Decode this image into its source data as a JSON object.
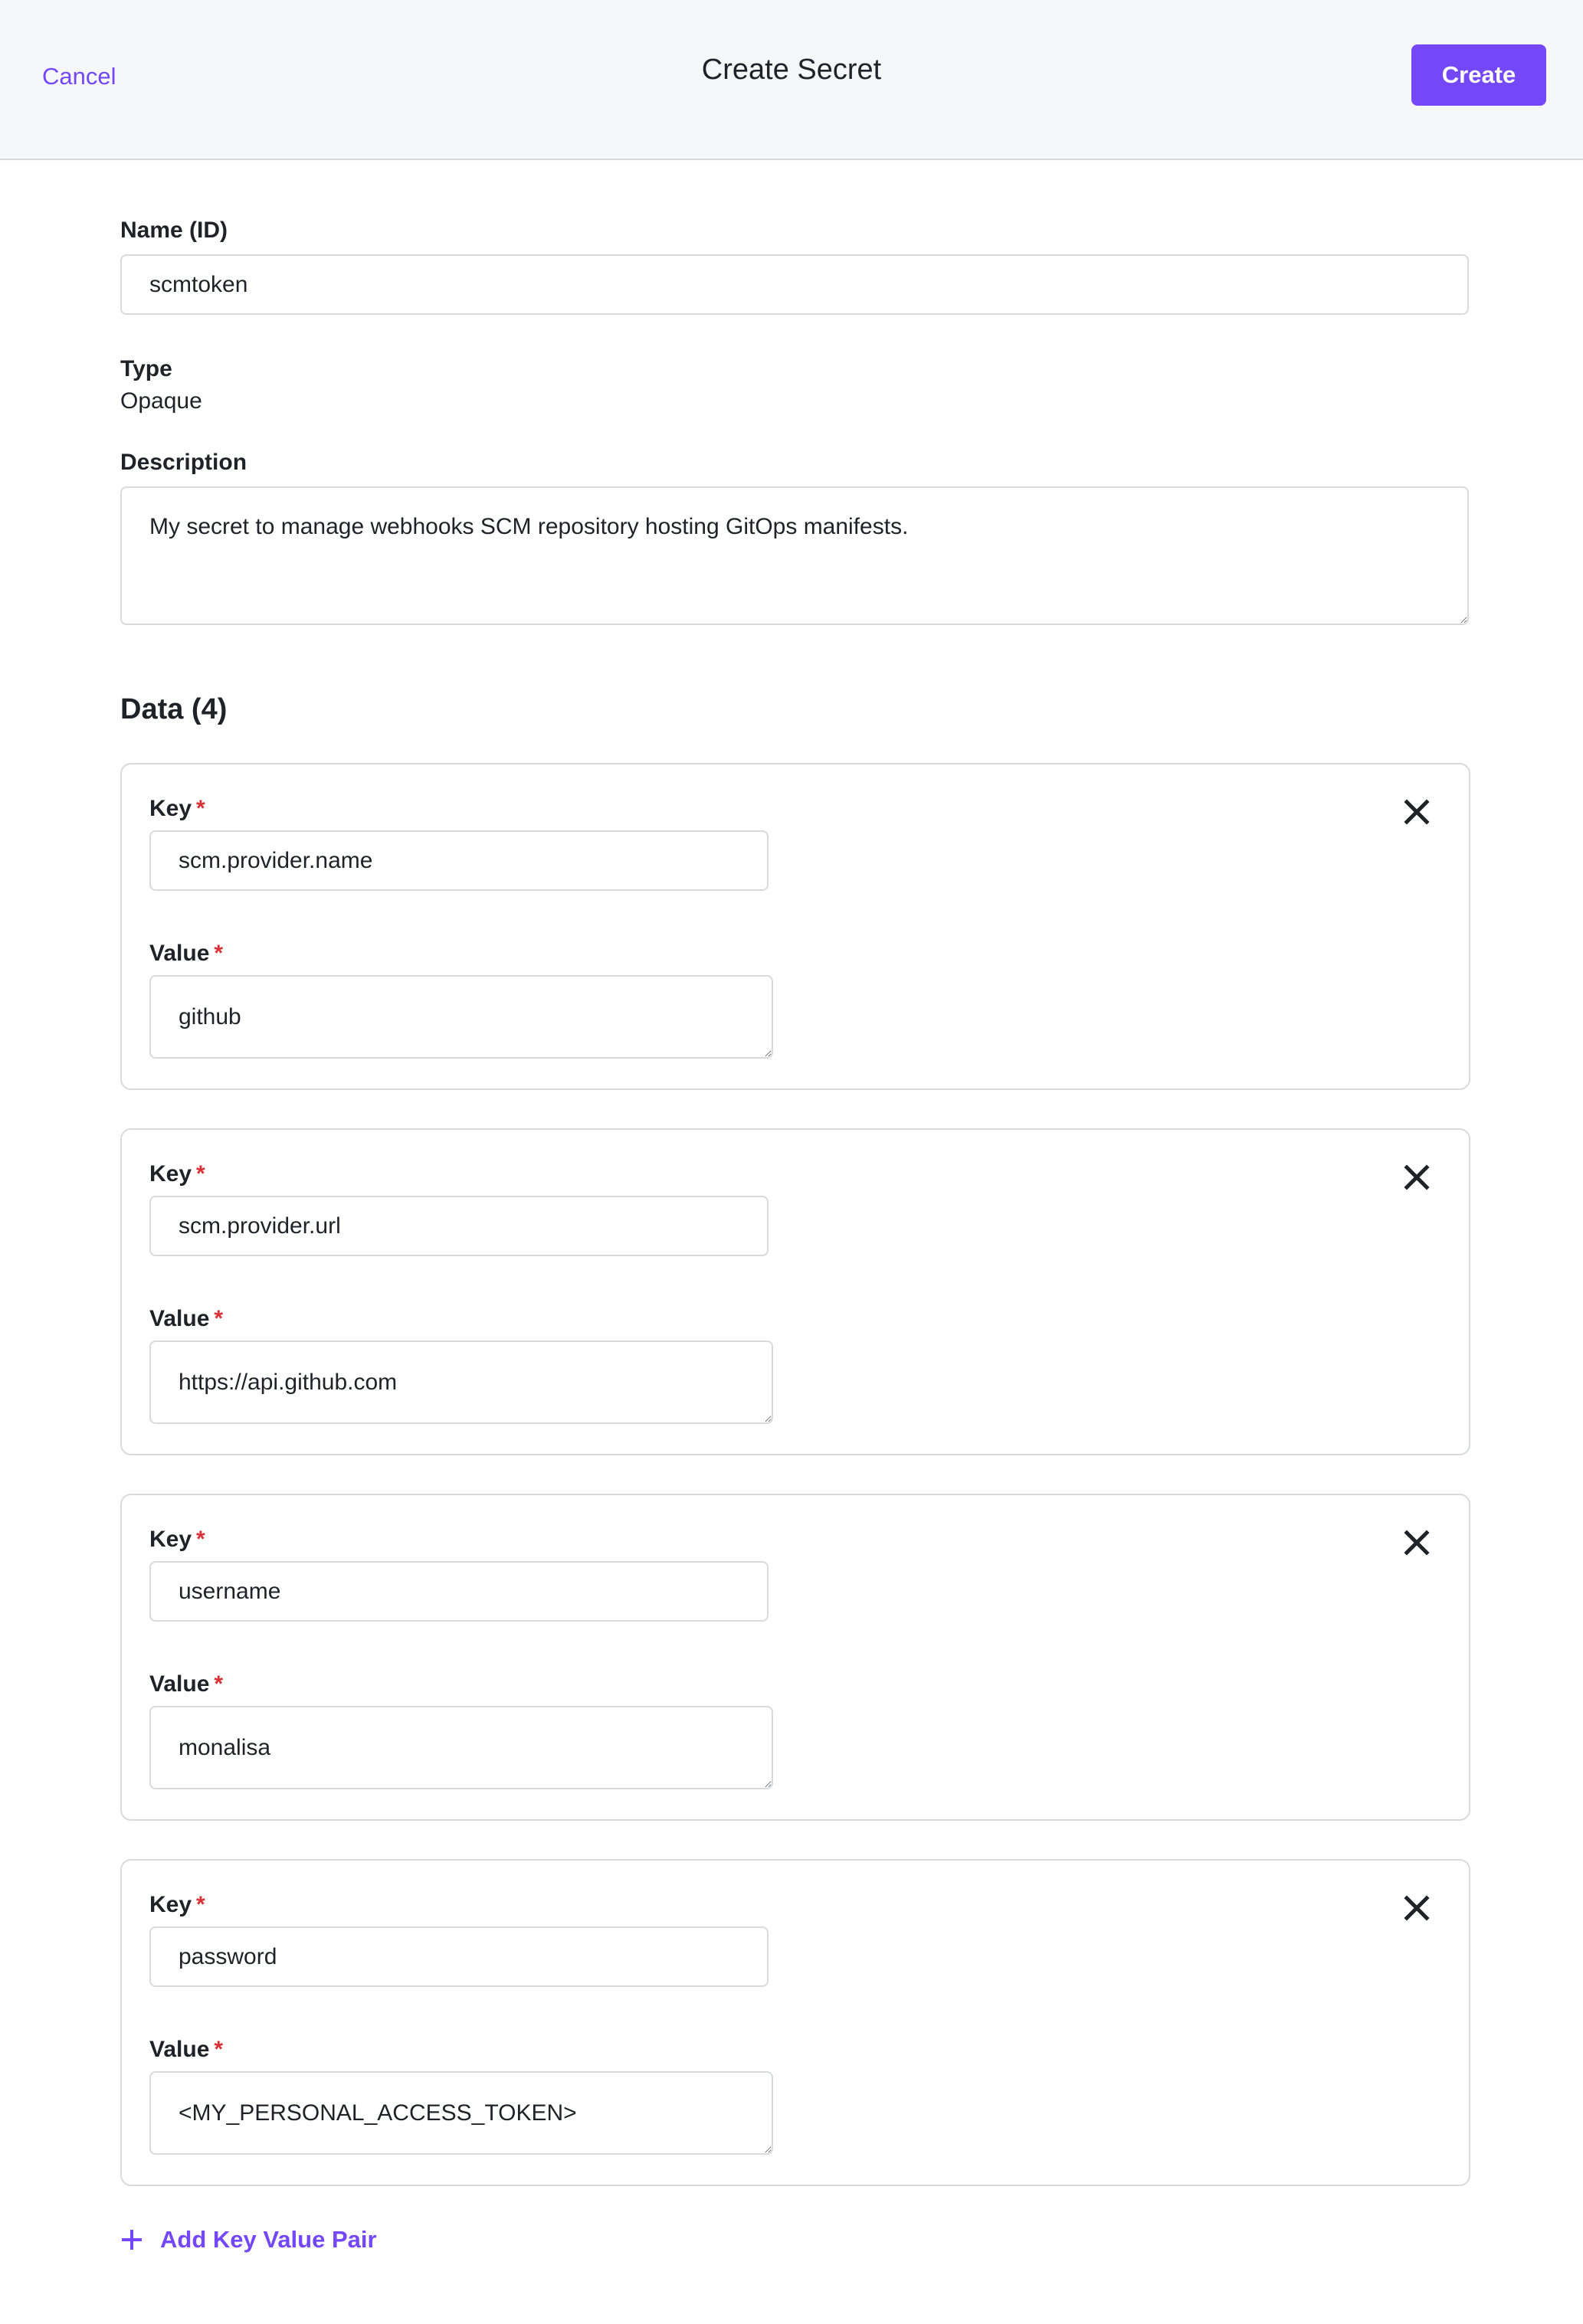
{
  "header": {
    "cancel_label": "Cancel",
    "title": "Create Secret",
    "create_label": "Create"
  },
  "colors": {
    "accent": "#7447f9",
    "required": "#d93036",
    "border": "#d8dade",
    "header_bg": "#f6f7f9",
    "text": "#1f2328"
  },
  "form": {
    "name": {
      "label": "Name (ID)",
      "value": "scmtoken"
    },
    "type": {
      "label": "Type",
      "value": "Opaque"
    },
    "description": {
      "label": "Description",
      "value": "My secret to manage webhooks SCM repository hosting GitOps manifests."
    },
    "data": {
      "heading": "Data (4)",
      "key_label": "Key",
      "value_label": "Value",
      "required_marker": "*",
      "pairs": [
        {
          "key": "scm.provider.name",
          "value": "github"
        },
        {
          "key": "scm.provider.url",
          "value": "https://api.github.com"
        },
        {
          "key": "username",
          "value": "monalisa"
        },
        {
          "key": "password",
          "value": "<MY_PERSONAL_ACCESS_TOKEN>"
        }
      ],
      "add_label": "Add Key Value Pair"
    }
  },
  "icons": {
    "remove": "close-icon",
    "add": "plus-icon"
  }
}
